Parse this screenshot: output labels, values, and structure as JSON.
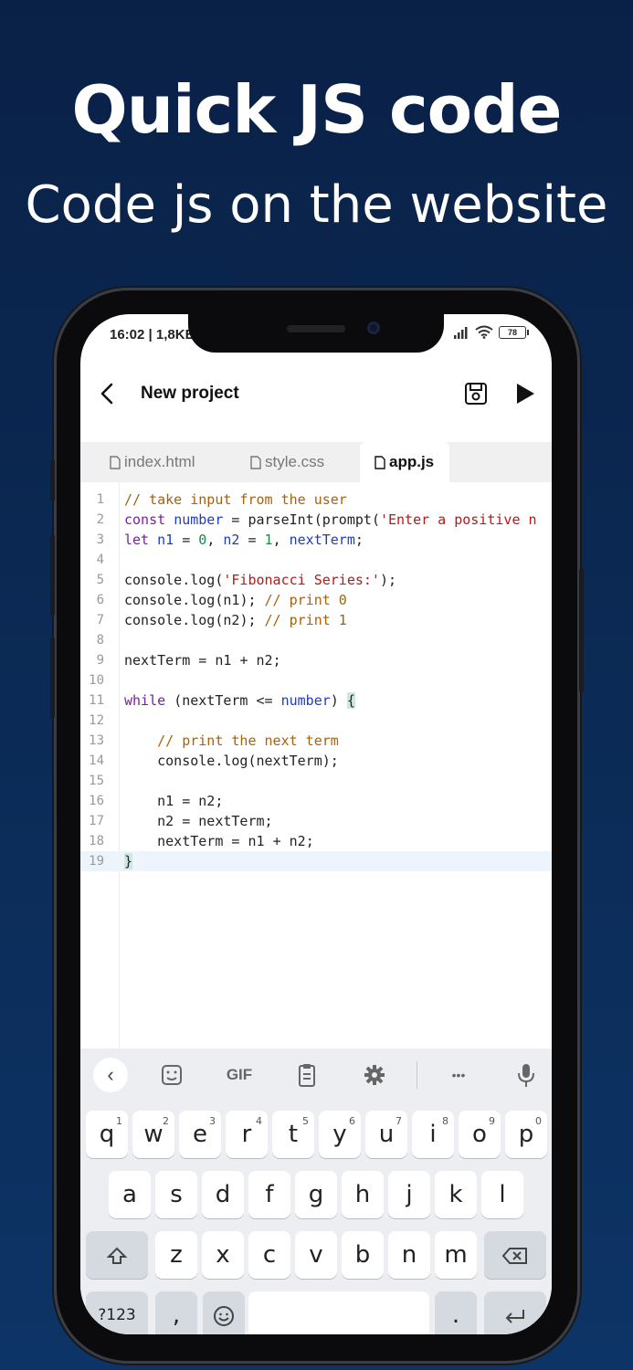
{
  "headline": "Quick JS code",
  "subline": "Code js on the website",
  "status": {
    "time": "16:02 | 1,8KB",
    "battery": "78"
  },
  "appbar": {
    "title": "New project"
  },
  "tabs": [
    {
      "label": "index.html"
    },
    {
      "label": "style.css"
    },
    {
      "label": "app.js"
    }
  ],
  "code": {
    "current_line": 19,
    "lines": [
      "// take input from the user",
      "const number = parseInt(prompt('Enter a positive n",
      "let n1 = 0, n2 = 1, nextTerm;",
      "",
      "console.log('Fibonacci Series:');",
      "console.log(n1); // print 0",
      "console.log(n2); // print 1",
      "",
      "nextTerm = n1 + n2;",
      "",
      "while (nextTerm <= number) {",
      "",
      "    // print the next term",
      "    console.log(nextTerm);",
      "",
      "    n1 = n2;",
      "    n2 = nextTerm;",
      "    nextTerm = n1 + n2;",
      "}"
    ]
  },
  "keyboard": {
    "toolbar": [
      "back-icon",
      "sticker-icon",
      "GIF",
      "clipboard-icon",
      "gear-icon",
      "more-icon",
      "mic-icon"
    ],
    "gif_label": "GIF",
    "more_label": "•••",
    "row1": [
      "q",
      "w",
      "e",
      "r",
      "t",
      "y",
      "u",
      "i",
      "o",
      "p"
    ],
    "row1_hints": [
      "1",
      "2",
      "3",
      "4",
      "5",
      "6",
      "7",
      "8",
      "9",
      "0"
    ],
    "row2": [
      "a",
      "s",
      "d",
      "f",
      "g",
      "h",
      "j",
      "k",
      "l"
    ],
    "row3": [
      "z",
      "x",
      "c",
      "v",
      "b",
      "n",
      "m"
    ],
    "row4": {
      "symbols": "?123",
      "comma": ",",
      "period": "."
    }
  }
}
